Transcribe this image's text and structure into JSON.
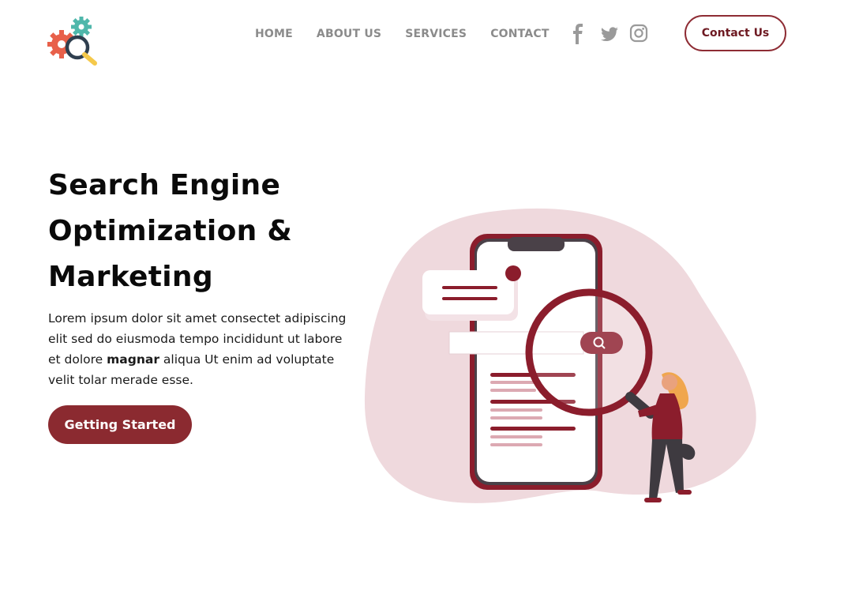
{
  "header": {
    "logo_icon": "gears-magnifier-logo-icon",
    "nav": [
      {
        "label": "HOME"
      },
      {
        "label": "ABOUT US"
      },
      {
        "label": "SERVICES"
      },
      {
        "label": "CONTACT"
      }
    ],
    "social_icons": [
      "facebook-icon",
      "twitter-icon",
      "instagram-icon"
    ],
    "contact_label": "Contact Us"
  },
  "hero": {
    "title": "Search Engine Optimization & Marketing",
    "text_before": "Lorem ipsum dolor sit amet consectet adipiscing elit sed do eiusmoda tempo incididunt ut labore et dolore ",
    "text_bold": "magnar",
    "text_after": " aliqua Ut enim ad voluptate velit tolar merade esse.",
    "cta_label": "Getting Started"
  },
  "colors": {
    "brand": "#8b2a30",
    "nav_text": "#8b8b8b",
    "blob": "#efd9dd"
  }
}
